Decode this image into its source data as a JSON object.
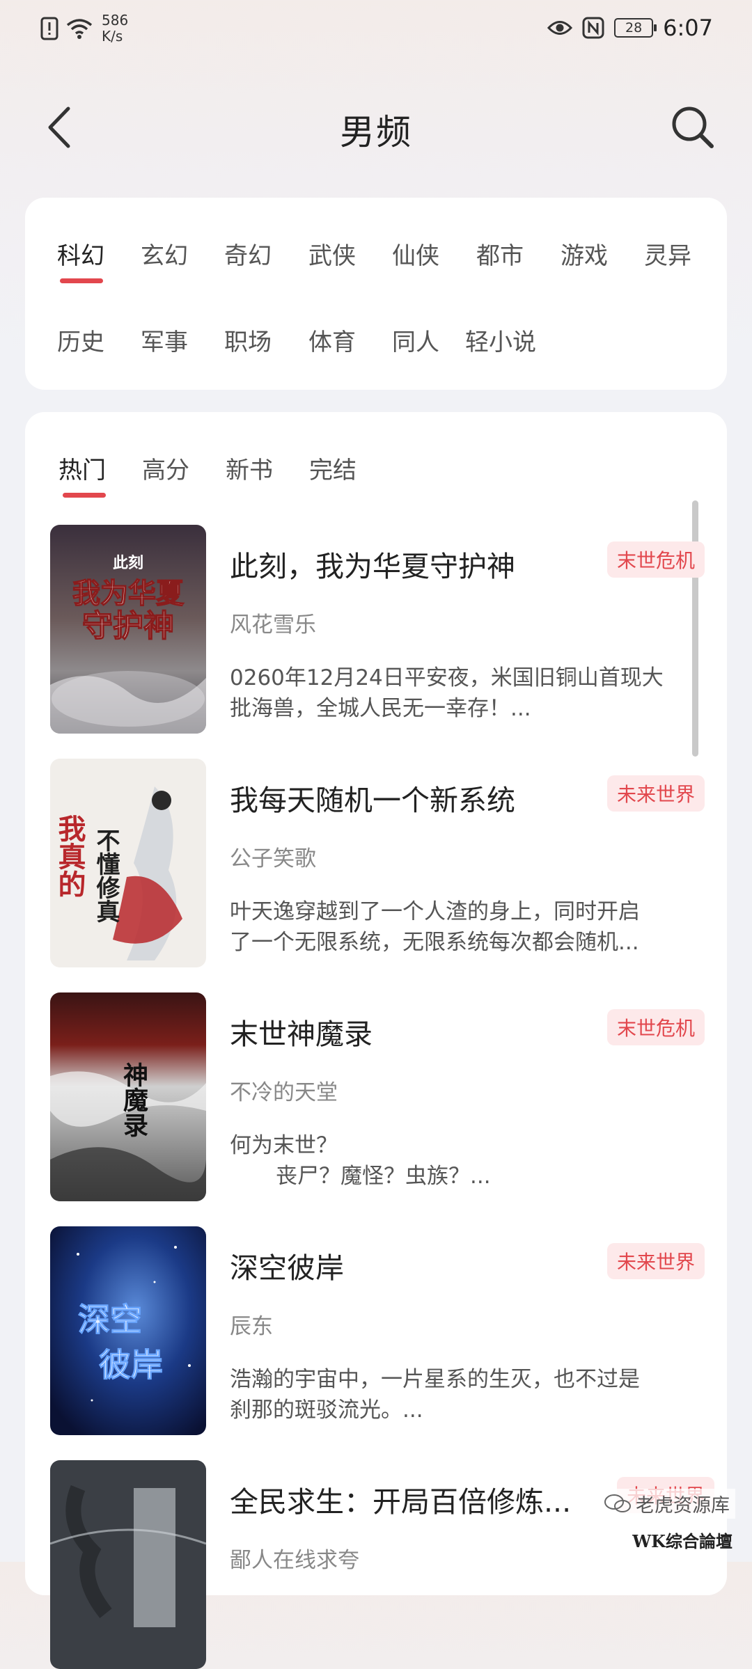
{
  "status_bar": {
    "speed_value": "586",
    "speed_unit": "K/s",
    "battery": "28",
    "time": "6:07"
  },
  "header": {
    "title": "男频",
    "back_icon": "chevron-left-icon",
    "search_icon": "search-icon"
  },
  "categories": {
    "row1": [
      "科幻",
      "玄幻",
      "奇幻",
      "武侠",
      "仙侠",
      "都市",
      "游戏",
      "灵异"
    ],
    "row2": [
      "历史",
      "军事",
      "职场",
      "体育",
      "同人",
      "轻小说"
    ],
    "active": "科幻"
  },
  "sub_tabs": {
    "items": [
      "热门",
      "高分",
      "新书",
      "完结"
    ],
    "active": "热门"
  },
  "books": [
    {
      "title": "此刻，我为华夏守护神",
      "tag": "末世危机",
      "author": "风花雪乐",
      "desc": [
        "0260年12月24日平安夜，米国旧铜山首现大",
        "批海兽，全城人民无一幸存！..."
      ],
      "cover_text": [
        "此刻",
        "我为华夏",
        "守护神"
      ]
    },
    {
      "title": "我每天随机一个新系统",
      "tag": "未来世界",
      "author": "公子笑歌",
      "desc": [
        "叶天逸穿越到了一个人渣的身上，同时开启",
        "了一个无限系统，无限系统每次都会随机..."
      ],
      "cover_text": [
        "我真的",
        "不懂修真"
      ]
    },
    {
      "title": "末世神魔录",
      "tag": "末世危机",
      "author": "不冷的天堂",
      "desc": [
        "何为末世？",
        "丧尸？魔怪？虫族？..."
      ],
      "cover_text": [
        "神魔录"
      ]
    },
    {
      "title": "深空彼岸",
      "tag": "未来世界",
      "author": "辰东",
      "desc": [
        "浩瀚的宇宙中，一片星系的生灭，也不过是",
        "刹那的斑驳流光。..."
      ],
      "cover_text": [
        "深空",
        "彼岸"
      ]
    },
    {
      "title": "全民求生：开局百倍修炼...",
      "tag": "未来世界",
      "author": "鄙人在线求夸",
      "desc": [],
      "cover_text": []
    }
  ],
  "watermark": {
    "line1": "老虎资源库",
    "line2": "WK综合論壇"
  },
  "colors": {
    "accent": "#e2474d",
    "tag_bg": "#fde9ea"
  }
}
